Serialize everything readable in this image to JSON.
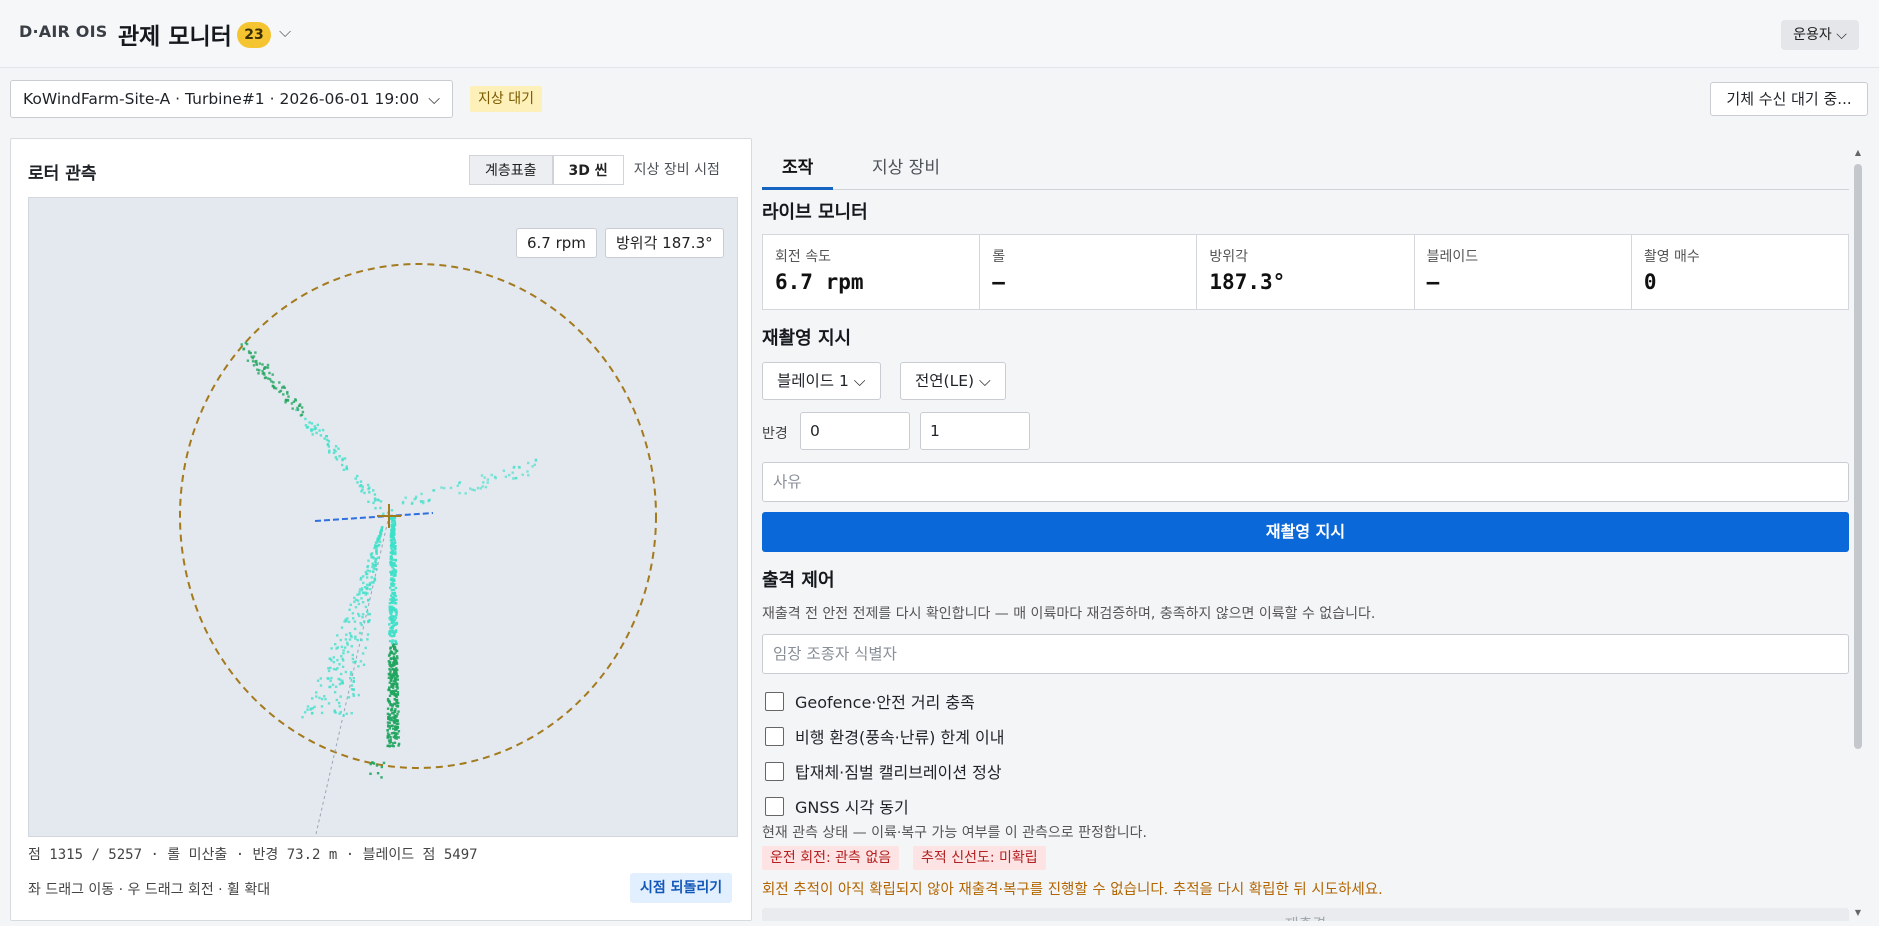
{
  "header": {
    "brand": "D·AIR OIS",
    "title": "관제 모니터",
    "badge_count": "23",
    "role_label": "운용자"
  },
  "session": {
    "selected": "KoWindFarm-Site-A · Turbine#1 · 2026-06-01 19:00",
    "status": "지상 대기",
    "wait_button": "기체 수신 대기 중..."
  },
  "rotor_panel": {
    "title": "로터 관측",
    "view_modes": [
      "계층표출",
      "3D 씬"
    ],
    "active_mode": "3D 씬",
    "ground_view_label": "지상 장비 시점",
    "rpm_chip": "6.7 rpm",
    "azimuth_chip": "방위각 187.3°",
    "stats_line": "점 1315 / 5257 · 롤 미산출 · 반경 73.2 m · 블레이드 점 5497",
    "help_text": "좌 드래그 이동 · 우 드래그 회전 · 휠 확대",
    "reset_button": "시점 되돌리기"
  },
  "tabs": {
    "control": "조작",
    "ground": "지상 장비"
  },
  "live_monitor": {
    "title": "라이브 모니터",
    "cells": [
      {
        "label": "회전 속도",
        "value": "6.7 rpm"
      },
      {
        "label": "롤",
        "value": "—"
      },
      {
        "label": "방위각",
        "value": "187.3°"
      },
      {
        "label": "블레이드",
        "value": "—"
      },
      {
        "label": "촬영 매수",
        "value": "0"
      }
    ]
  },
  "reshoot": {
    "title": "재촬영 지시",
    "blade_select": "블레이드 1",
    "edge_select": "전연(LE)",
    "radius_label": "반경",
    "radius_from": "0",
    "radius_to": "1",
    "reason_placeholder": "사유",
    "submit_button": "재촬영 지시"
  },
  "launch": {
    "title": "출격 제어",
    "description": "재출격 전 안전 전제를 다시 확인합니다 — 매 이륙마다 재검증하며, 충족하지 않으면 이륙할 수 없습니다.",
    "pilot_placeholder": "임장 조종자 식별자",
    "checks": [
      "Geofence·안전 거리 충족",
      "비행 환경(풍속·난류) 한계 이내",
      "탑재체·짐벌 캘리브레이션 정상",
      "GNSS 시각 동기"
    ],
    "observation_note": "현재 관측 상태 — 이륙·복구 가능 여부를 이 관측으로 판정합니다.",
    "tags": [
      "운전 회전: 관측 없음",
      "추적 신선도: 미확립"
    ],
    "warning": "회전 추적이 아직 확립되지 않아 재출격·복구를 진행할 수 없습니다. 추적을 다시 확립한 뒤 시도하세요.",
    "disabled_button": "재출격"
  },
  "colors": {
    "accent": "#0b68d8",
    "badge": "#f5c431",
    "rotor_circle": "#a37a1c",
    "point_light": "#3de0c8",
    "point_dark": "#1fa55e",
    "axis": "#2f6fe0"
  }
}
